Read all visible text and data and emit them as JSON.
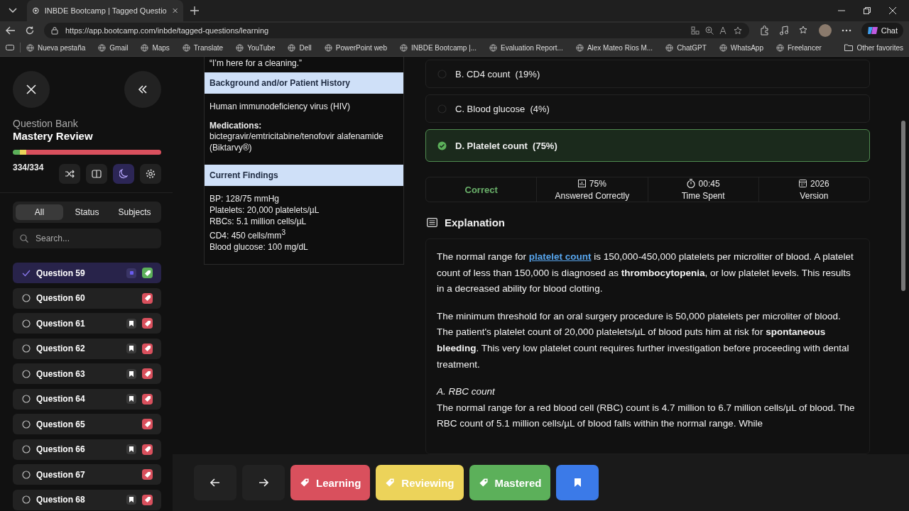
{
  "browser": {
    "tab_title": "INBDE Bootcamp | Tagged Questio",
    "url": "https://app.bootcamp.com/inbde/tagged-questions/learning",
    "chat_label": "Chat",
    "bookmarks": [
      "Nueva pestaña",
      "Gmail",
      "Maps",
      "Translate",
      "YouTube",
      "Dell",
      "PowerPoint web",
      "INBDE Bootcamp |...",
      "Evaluation Report...",
      "Alex Mateo Rios M...",
      "ChatGPT",
      "WhatsApp",
      "Freelancer"
    ],
    "other_favorites": "Other favorites"
  },
  "sidebar": {
    "subtitle": "Question Bank",
    "title": "Mastery Review",
    "progress": [
      {
        "kind": "mastered",
        "level": 0.05
      },
      {
        "kind": "reviewing",
        "level": 0.04
      },
      {
        "kind": "learning",
        "level": 0.91
      }
    ],
    "count": "334/334",
    "tools": [
      {
        "kind": "shuffle",
        "selected": false
      },
      {
        "kind": "split",
        "selected": false
      },
      {
        "kind": "moon",
        "selected": true
      },
      {
        "kind": "settings",
        "selected": false
      }
    ],
    "filters": [
      {
        "label": "All",
        "selected": true
      },
      {
        "label": "Status",
        "selected": false
      },
      {
        "label": "Subjects",
        "selected": false
      }
    ],
    "search": {
      "placeholder": "Search..."
    },
    "questions": [
      {
        "label": "Question 59",
        "selected": true,
        "bookmarked": false,
        "color": "#5cb05a"
      },
      {
        "label": "Question 60",
        "selected": false,
        "bookmarked": false,
        "color": "#d9505d"
      },
      {
        "label": "Question 61",
        "selected": false,
        "bookmarked": true,
        "color": "#d9505d"
      },
      {
        "label": "Question 62",
        "selected": false,
        "bookmarked": true,
        "color": "#d9505d"
      },
      {
        "label": "Question 63",
        "selected": false,
        "bookmarked": true,
        "color": "#d9505d"
      },
      {
        "label": "Question 64",
        "selected": false,
        "bookmarked": true,
        "color": "#d9505d"
      },
      {
        "label": "Question 65",
        "selected": false,
        "bookmarked": false,
        "color": "#d9505d"
      },
      {
        "label": "Question 66",
        "selected": false,
        "bookmarked": true,
        "color": "#d9505d"
      },
      {
        "label": "Question 67",
        "selected": false,
        "bookmarked": false,
        "color": "#d9505d"
      },
      {
        "label": "Question 68",
        "selected": false,
        "bookmarked": true,
        "color": "#d9505d"
      }
    ]
  },
  "case": {
    "quote": "“I’m here for a cleaning.”",
    "sections": [
      {
        "heading": "Background and/or Patient History",
        "paragraphs": [
          {
            "lines": [
              "Human immunodeficiency virus (HIV)"
            ]
          },
          {
            "label": "Medications:",
            "lines": [
              "bictegravir/emtricitabine/tenofovir alafenamide (Biktarvy®)"
            ]
          }
        ]
      },
      {
        "heading": "Current Findings",
        "paragraphs": [
          {
            "lines": [
              "BP: 128/75 mmHg",
              "Platelets: 20,000 platelets/µL",
              "RBCs: 5.1 million cells/µL",
              "CD4: 450 cells/mm$^{3}$",
              "Blood glucose: 100 mg/dL"
            ]
          }
        ]
      }
    ]
  },
  "answers": [
    {
      "label": "B. CD4 count",
      "percent": "(19%)",
      "selected": false
    },
    {
      "label": "C. Blood glucose",
      "percent": "(4%)",
      "selected": false
    },
    {
      "label": "D. Platelet count",
      "percent": "(75%)",
      "selected": true
    }
  ],
  "result": {
    "label": "Correct",
    "stats": [
      {
        "kind": "chart",
        "value": "75%",
        "label": "Answered Correctly"
      },
      {
        "kind": "timer",
        "value": "00:45",
        "label": "Time Spent"
      },
      {
        "kind": "calendar",
        "value": "2026",
        "label": "Version"
      }
    ]
  },
  "explanation": {
    "heading": "Explanation",
    "blocks": [
      {
        "kind": "paragraph",
        "parts": [
          {
            "kind": "text",
            "text": "The normal range for "
          },
          {
            "kind": "link",
            "text": "platelet count"
          },
          {
            "kind": "text",
            "text": " is 150,000-450,000 platelets per microliter of blood. A platelet count of less than 150,000 is diagnosed as **thrombocytopenia**, or low platelet levels. This results in a decreased ability for blood clotting."
          }
        ]
      },
      {
        "kind": "paragraph",
        "parts": [
          {
            "kind": "text",
            "text": "The minimum threshold for an oral surgery procedure is 50,000 platelets per microliter of blood. The patient's platelet count of 20,000 platelets/µL of blood puts him at risk for **spontaneous bleeding**. This very low platelet count requires further investigation before proceeding with dental treatment."
          }
        ]
      },
      {
        "kind": "subheading",
        "parts": [
          {
            "kind": "text",
            "text": "A. RBC count"
          }
        ]
      },
      {
        "kind": "paragraph",
        "parts": [
          {
            "kind": "text",
            "text": "The normal range for a red blood cell (RBC) count is 4.7 million to 6.7 million cells/µL of blood. The RBC count of 5.1 million cells/µL of blood falls within the normal range. While"
          }
        ]
      }
    ]
  },
  "footer": {
    "tags": [
      {
        "kind": "learning",
        "label": "Learning"
      },
      {
        "kind": "reviewing",
        "label": "Reviewing"
      },
      {
        "kind": "mastered",
        "label": "Mastered"
      }
    ]
  }
}
